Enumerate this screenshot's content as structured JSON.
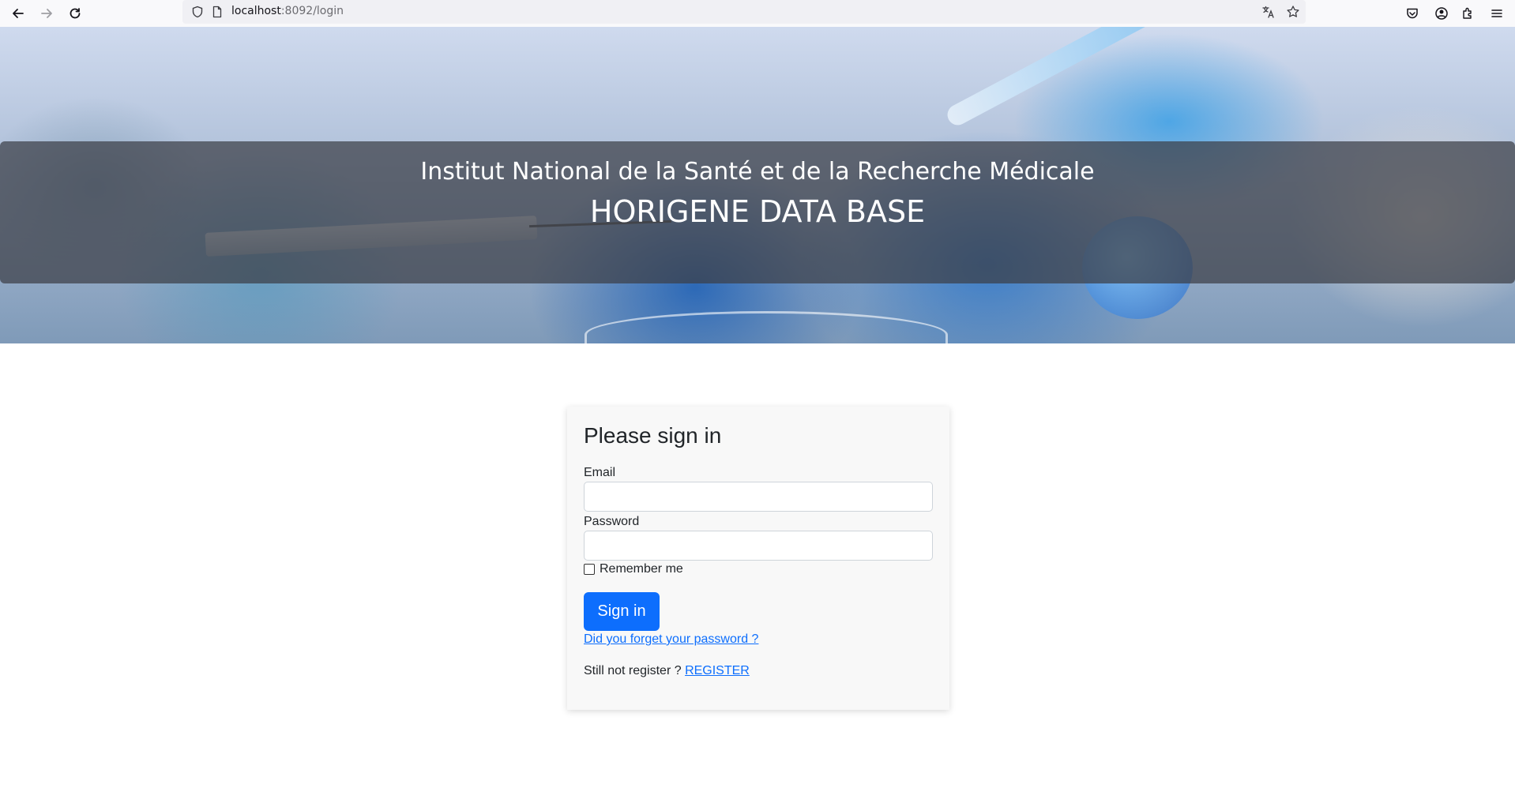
{
  "browser": {
    "url_host": "localhost",
    "url_path": ":8092/login",
    "icons": [
      "back-icon",
      "forward-icon",
      "reload-icon",
      "shield-icon",
      "page-icon",
      "translate-icon",
      "bookmark-star-icon",
      "pocket-icon",
      "account-icon",
      "extensions-icon",
      "menu-icon"
    ]
  },
  "hero": {
    "subtitle": "Institut National de la Santé et de la Recherche Médicale",
    "title": "HORIGENE DATA BASE"
  },
  "login": {
    "heading": "Please sign in",
    "email_label": "Email",
    "email_value": "",
    "password_label": "Password",
    "password_value": "",
    "remember_label": "Remember me",
    "remember_checked": false,
    "submit_label": "Sign in",
    "forgot_link": "Did you forget your password ?",
    "register_prompt": "Still not register ?",
    "register_link": "REGISTER"
  },
  "colors": {
    "primary": "#0d6efd",
    "card_bg": "#f8f8f8",
    "overlay": "#3c3e46"
  }
}
